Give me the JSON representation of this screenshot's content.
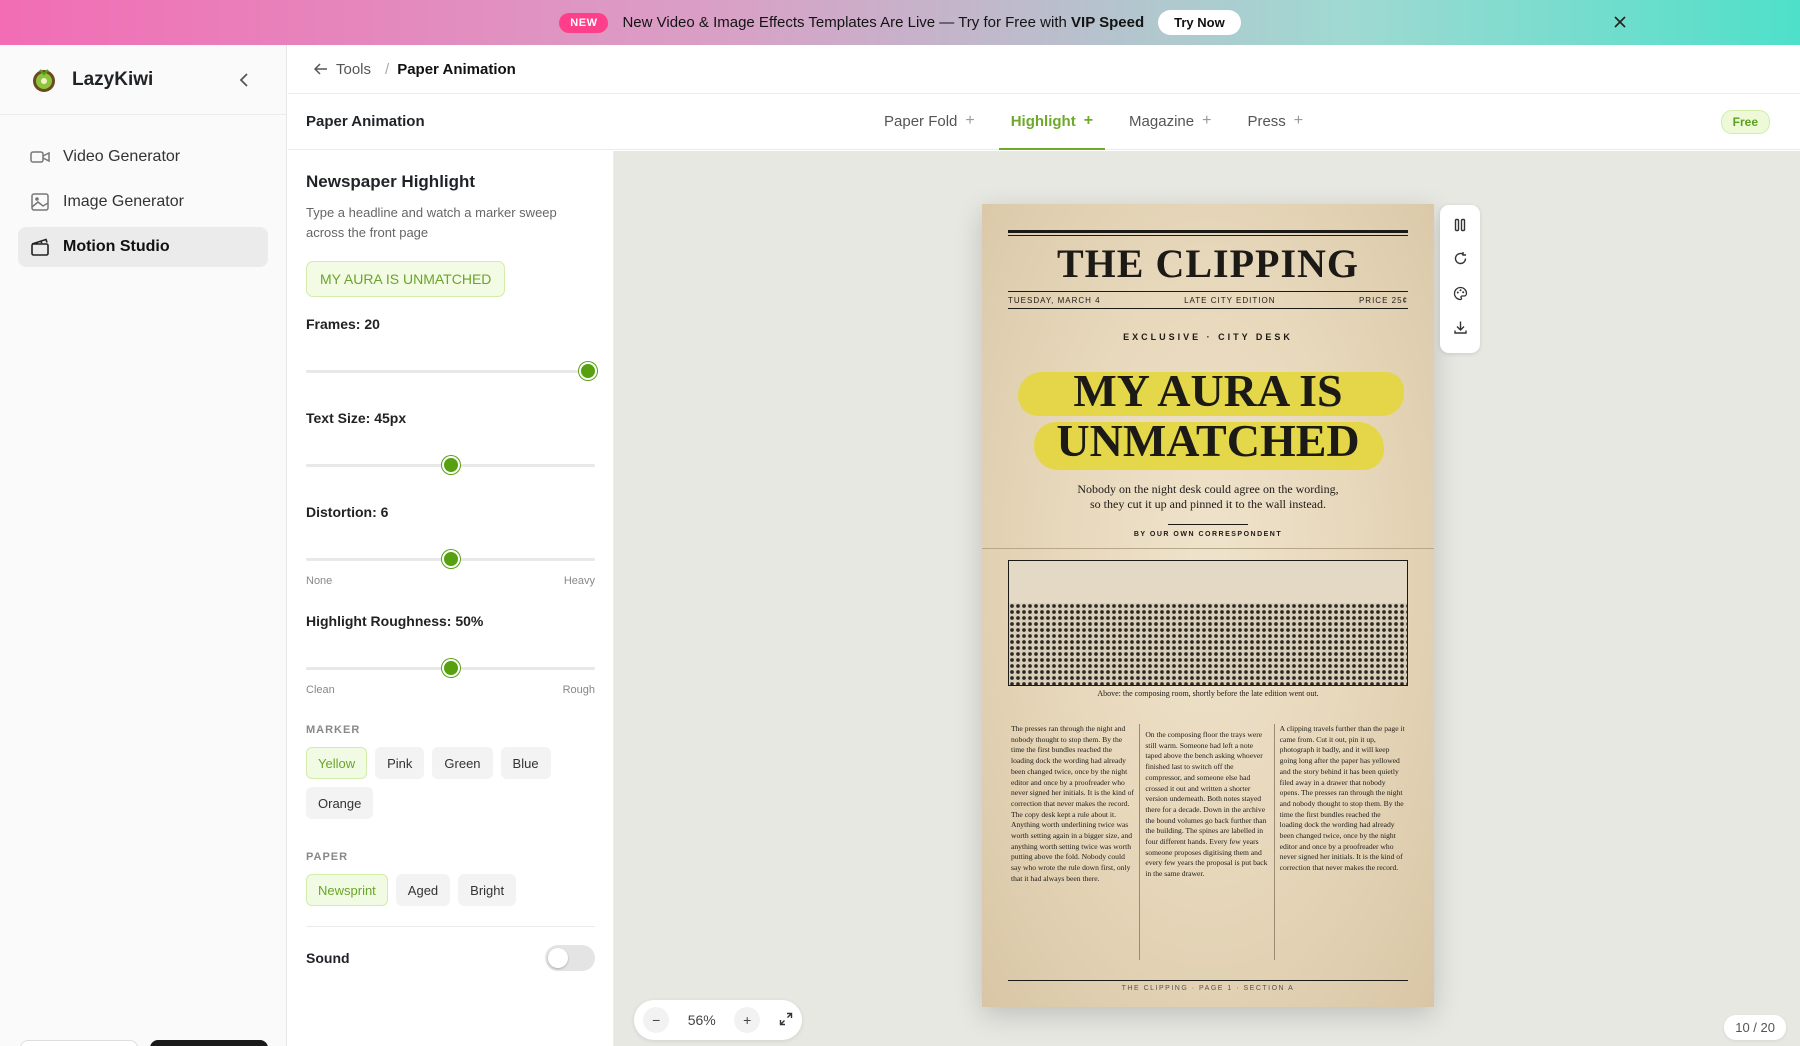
{
  "banner": {
    "badge": "NEW",
    "text": "New Video & Image Effects Templates Are Live — Try for Free with",
    "highlight": "VIP Speed",
    "cta": "Try Now"
  },
  "sidebar": {
    "brand": "LazyKiwi",
    "items": [
      {
        "label": "Video Generator",
        "icon": "video-camera-icon"
      },
      {
        "label": "Image Generator",
        "icon": "image-icon"
      },
      {
        "label": "Motion Studio",
        "icon": "clapperboard-icon",
        "active": true
      }
    ]
  },
  "breadcrumb": {
    "back": "Tools",
    "sep": "/",
    "current": "Paper Animation"
  },
  "tabsbar": {
    "page_name": "Paper Animation",
    "tabs": [
      {
        "label": "Paper Fold",
        "plus": "+"
      },
      {
        "label": "Highlight",
        "plus": "+",
        "active": true
      },
      {
        "label": "Magazine",
        "plus": "+"
      },
      {
        "label": "Press",
        "plus": "+"
      }
    ],
    "plan": "Free"
  },
  "panel": {
    "title": "Newspaper Highlight",
    "description": "Type a headline and watch a marker sweep across the front page",
    "headline_value": "MY AURA IS UNMATCHED",
    "frames": {
      "label": "Frames: 20",
      "value": 20,
      "min": 0,
      "max": 20
    },
    "text_size": {
      "label": "Text Size: 45px",
      "value": 45,
      "min": 0,
      "max": 90
    },
    "distortion": {
      "label": "Distortion: 6",
      "value": 6,
      "min": 0,
      "max": 12,
      "min_label": "None",
      "max_label": "Heavy"
    },
    "roughness": {
      "label": "Highlight Roughness: 50%",
      "value": 50,
      "min": 0,
      "max": 100,
      "min_label": "Clean",
      "max_label": "Rough"
    },
    "marker": {
      "heading": "MARKER",
      "options": [
        "Yellow",
        "Pink",
        "Green",
        "Blue",
        "Orange"
      ],
      "selected": "Yellow"
    },
    "paper": {
      "heading": "PAPER",
      "options": [
        "Newsprint",
        "Aged",
        "Bright"
      ],
      "selected": "Newsprint"
    },
    "sound": {
      "label": "Sound",
      "on": false
    }
  },
  "newspaper": {
    "masthead": "THE CLIPPING",
    "date": "TUESDAY, MARCH 4",
    "edition": "LATE CITY EDITION",
    "price": "PRICE 25¢",
    "kicker": "EXCLUSIVE · CITY DESK",
    "headline_line1": "MY AURA IS",
    "headline_line2": "UNMATCHED",
    "dek_line1": "Nobody on the night desk could agree on the wording,",
    "dek_line2": "so they cut it up and pinned it to the wall instead.",
    "byline": "BY OUR OWN CORRESPONDENT",
    "caption": "Above: the composing room, shortly before the late edition went out.",
    "col1": "The presses ran through the night and nobody thought to stop them. By the time the first bundles reached the loading dock the wording had already been changed twice, once by the night editor and once by a proofreader who never signed her initials. It is the kind of correction that never makes the record. The copy desk kept a rule about it. Anything worth underlining twice was worth setting again in a bigger size, and anything worth setting twice was worth putting above the fold. Nobody could say who wrote the rule down first, only that it had always been there.",
    "col2": "On the composing floor the trays were still warm. Someone had left a note taped above the bench asking whoever finished last to switch off the compressor, and someone else had crossed it out and written a shorter version underneath. Both notes stayed there for a decade. Down in the archive the bound volumes go back further than the building. The spines are labelled in four different hands. Every few years someone proposes digitising them and every few years the proposal is put back in the same drawer.",
    "col3": "A clipping travels further than the page it came from. Cut it out, pin it up, photograph it badly, and it will keep going long after the paper has yellowed and the story behind it has been quietly filed away in a drawer that nobody opens. The presses ran through the night and nobody thought to stop them. By the time the first bundles reached the loading dock the wording had already been changed twice, once by the night editor and once by a proofreader who never signed her initials. It is the kind of correction that never makes the record.",
    "footer": "THE CLIPPING · PAGE 1 · SECTION A"
  },
  "canvas": {
    "zoom": "56%",
    "zoom_out": "−",
    "zoom_in": "+",
    "frame_counter": "10 / 20"
  },
  "colors": {
    "accent": "#57a010",
    "marker": "#e3d63c",
    "paper": "#e7d7ba"
  }
}
